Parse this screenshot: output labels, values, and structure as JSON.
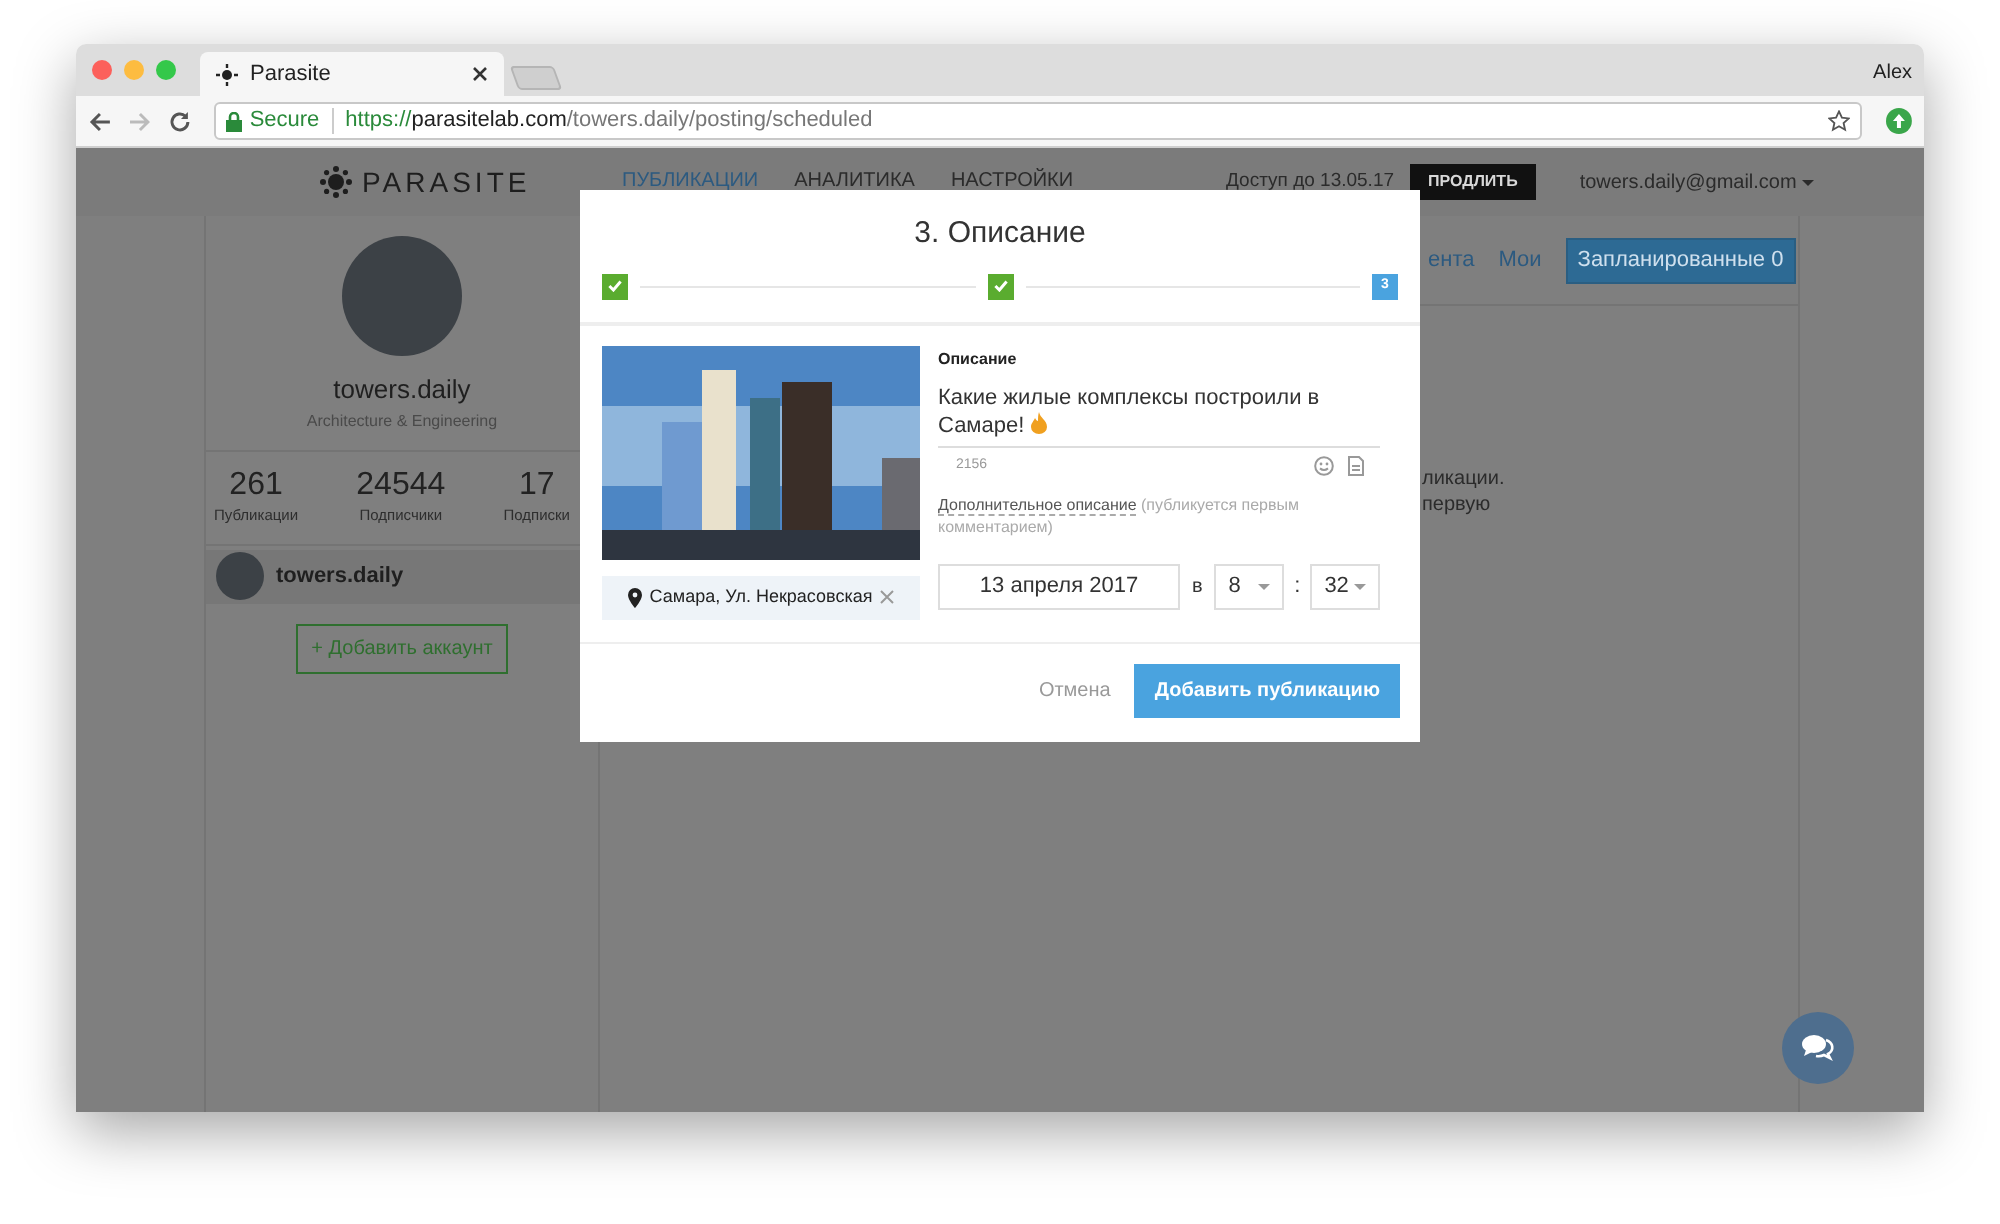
{
  "browser": {
    "tab_title": "Parasite",
    "profile": "Alex",
    "url": {
      "secure_label": "Secure",
      "scheme": "https://",
      "host": "parasitelab.com",
      "path": "/towers.daily/posting/scheduled"
    }
  },
  "header": {
    "logo": "PARASITE",
    "nav": [
      {
        "label": "ПУБЛИКАЦИИ",
        "selected": true
      },
      {
        "label": "АНАЛИТИКА",
        "selected": false
      },
      {
        "label": "НАСТРОЙКИ",
        "selected": false
      }
    ],
    "access": "Доступ до 13.05.17",
    "renew_button": "ПРОДЛИТЬ",
    "account": "towers.daily@gmail.com"
  },
  "profile": {
    "name": "towers.daily",
    "subtitle": "Architecture & Engineering",
    "stats": [
      {
        "value": "261",
        "label": "Публикации"
      },
      {
        "value": "24544",
        "label": "Подписчики"
      },
      {
        "value": "17",
        "label": "Подписки"
      }
    ],
    "accounts": [
      {
        "name": "towers.daily"
      }
    ],
    "add_account_button": "+ Добавить аккаунт"
  },
  "content_tabs": [
    {
      "label": "ента",
      "selected": false
    },
    {
      "label": "Мои",
      "selected": false
    },
    {
      "label": "Запланированные 0",
      "selected": true
    }
  ],
  "content_text": [
    "ликации.",
    "первую"
  ],
  "modal": {
    "title": "3. Описание",
    "steps": [
      {
        "kind": "done"
      },
      {
        "kind": "done"
      },
      {
        "kind": "current",
        "label": "3"
      }
    ],
    "location": "Самара, Ул. Некрасовская",
    "description_label": "Описание",
    "description": "Какие жилые комплексы построили в Самаре!",
    "char_count": "2156",
    "extra_link": "Дополнительное описание",
    "extra_hint": "(публикуется первым комментарием)",
    "date": "13 апреля 2017",
    "at": "в",
    "hour": "8",
    "separator": ":",
    "minute": "32",
    "cancel": "Отмена",
    "submit": "Добавить публикацию"
  }
}
